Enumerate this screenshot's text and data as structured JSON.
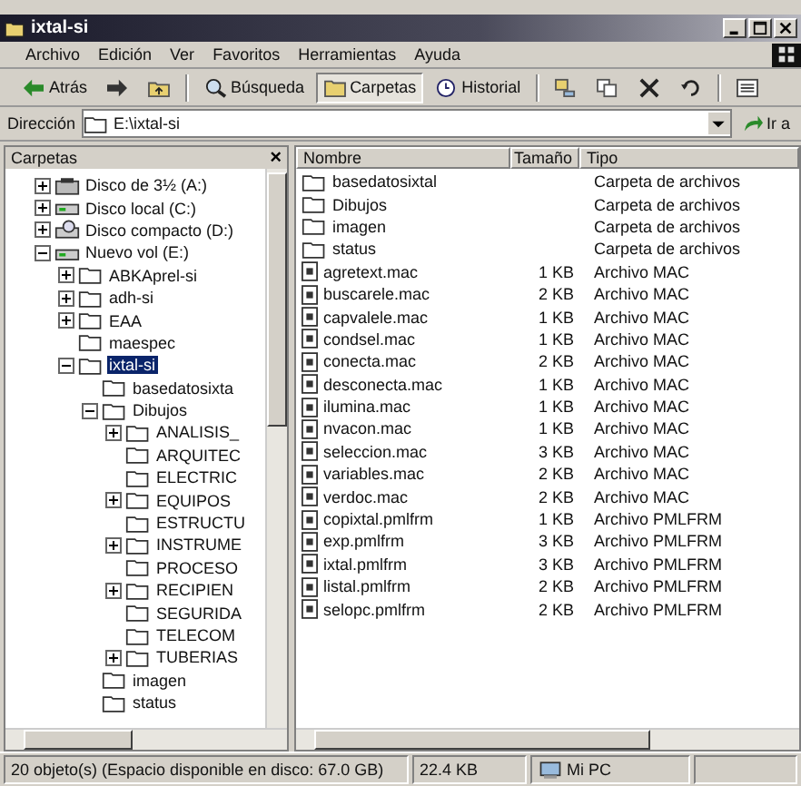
{
  "window": {
    "title": "ixtal-si"
  },
  "menu": [
    "Archivo",
    "Edición",
    "Ver",
    "Favoritos",
    "Herramientas",
    "Ayuda"
  ],
  "toolbar": [
    {
      "kind": "back",
      "label": "Atrás",
      "pressed": false
    },
    {
      "kind": "forward",
      "pressed": false
    },
    {
      "kind": "up",
      "pressed": false
    },
    {
      "kind": "search",
      "label": "Búsqueda",
      "pressed": false
    },
    {
      "kind": "folders",
      "label": "Carpetas",
      "pressed": true
    },
    {
      "kind": "history",
      "label": "Historial",
      "pressed": false
    },
    {
      "kind": "move",
      "pressed": false
    },
    {
      "kind": "copy",
      "pressed": false
    },
    {
      "kind": "delete",
      "pressed": false
    },
    {
      "kind": "undo",
      "pressed": false
    },
    {
      "kind": "views",
      "pressed": false
    }
  ],
  "address": {
    "label": "Dirección",
    "value": "E:\\ixtal-si",
    "go": "Ir a"
  },
  "folders_pane": {
    "title": "Carpetas",
    "close": "×"
  },
  "tree": [
    {
      "label": "Disco de 3½ (A:)",
      "kind": "floppy",
      "expanded": false,
      "selected": false
    },
    {
      "label": "Disco local (C:)",
      "kind": "drive",
      "expanded": false,
      "selected": false
    },
    {
      "label": "Disco compacto (D:)",
      "kind": "cd",
      "expanded": false,
      "selected": false
    },
    {
      "label": "Nuevo vol (E:)",
      "kind": "drive",
      "expanded": true,
      "selected": false,
      "children": [
        {
          "label": "ABKAprel-si",
          "kind": "folder",
          "expanded": false,
          "selected": false
        },
        {
          "label": "adh-si",
          "kind": "folder",
          "expanded": false,
          "selected": false
        },
        {
          "label": "EAA",
          "kind": "folder",
          "expanded": false,
          "selected": false
        },
        {
          "label": "maespec",
          "kind": "folder",
          "selected": false
        },
        {
          "label": "ixtal-si",
          "kind": "folder",
          "expanded": true,
          "selected": true,
          "children": [
            {
              "label": "basedatosixta",
              "kind": "folder",
              "selected": false
            },
            {
              "label": "Dibujos",
              "kind": "folder",
              "expanded": true,
              "selected": false,
              "children": [
                {
                  "label": "ANALISIS_",
                  "kind": "folder",
                  "expanded": false,
                  "selected": false
                },
                {
                  "label": "ARQUITEC",
                  "kind": "folder",
                  "selected": false
                },
                {
                  "label": "ELECTRIC",
                  "kind": "folder",
                  "selected": false
                },
                {
                  "label": "EQUIPOS",
                  "kind": "folder",
                  "expanded": false,
                  "selected": false
                },
                {
                  "label": "ESTRUCTU",
                  "kind": "folder",
                  "selected": false
                },
                {
                  "label": "INSTRUME",
                  "kind": "folder",
                  "expanded": false,
                  "selected": false
                },
                {
                  "label": "PROCESO",
                  "kind": "folder",
                  "selected": false
                },
                {
                  "label": "RECIPIEN",
                  "kind": "folder",
                  "expanded": false,
                  "selected": false
                },
                {
                  "label": "SEGURIDA",
                  "kind": "folder",
                  "selected": false
                },
                {
                  "label": "TELECOM",
                  "kind": "folder",
                  "selected": false
                },
                {
                  "label": "TUBERIAS",
                  "kind": "folder",
                  "expanded": false,
                  "selected": false
                }
              ]
            },
            {
              "label": "imagen",
              "kind": "folder",
              "selected": false
            },
            {
              "label": "status",
              "kind": "folder",
              "selected": false
            }
          ]
        }
      ]
    }
  ],
  "table": {
    "columns": [
      "Nombre",
      "Tamaño",
      "Tipo"
    ],
    "rows": [
      {
        "kind": "folder",
        "name": "basedatosixtal",
        "type": "Carpeta de archivos"
      },
      {
        "kind": "folder",
        "name": "Dibujos",
        "type": "Carpeta de archivos"
      },
      {
        "kind": "folder",
        "name": "imagen",
        "type": "Carpeta de archivos"
      },
      {
        "kind": "folder",
        "name": "status",
        "type": "Carpeta de archivos"
      },
      {
        "kind": "file",
        "name": "agretext.mac",
        "size": "1 KB",
        "type": "Archivo MAC"
      },
      {
        "kind": "file",
        "name": "buscarele.mac",
        "size": "2 KB",
        "type": "Archivo MAC"
      },
      {
        "kind": "file",
        "name": "capvalele.mac",
        "size": "1 KB",
        "type": "Archivo MAC"
      },
      {
        "kind": "file",
        "name": "condsel.mac",
        "size": "1 KB",
        "type": "Archivo MAC"
      },
      {
        "kind": "file",
        "name": "conecta.mac",
        "size": "2 KB",
        "type": "Archivo MAC"
      },
      {
        "kind": "file",
        "name": "desconecta.mac",
        "size": "1 KB",
        "type": "Archivo MAC"
      },
      {
        "kind": "file",
        "name": "ilumina.mac",
        "size": "1 KB",
        "type": "Archivo MAC"
      },
      {
        "kind": "file",
        "name": "nvacon.mac",
        "size": "1 KB",
        "type": "Archivo MAC"
      },
      {
        "kind": "file",
        "name": "seleccion.mac",
        "size": "3 KB",
        "type": "Archivo MAC"
      },
      {
        "kind": "file",
        "name": "variables.mac",
        "size": "2 KB",
        "type": "Archivo MAC"
      },
      {
        "kind": "file",
        "name": "verdoc.mac",
        "size": "2 KB",
        "type": "Archivo MAC"
      },
      {
        "kind": "file",
        "name": "copixtal.pmlfrm",
        "size": "1 KB",
        "type": "Archivo PMLFRM"
      },
      {
        "kind": "file",
        "name": "exp.pmlfrm",
        "size": "3 KB",
        "type": "Archivo PMLFRM"
      },
      {
        "kind": "file",
        "name": "ixtal.pmlfrm",
        "size": "3 KB",
        "type": "Archivo PMLFRM"
      },
      {
        "kind": "file",
        "name": "listal.pmlfrm",
        "size": "2 KB",
        "type": "Archivo PMLFRM"
      },
      {
        "kind": "file",
        "name": "selopc.pmlfrm",
        "size": "2 KB",
        "type": "Archivo PMLFRM"
      }
    ]
  },
  "status_bar": [
    "20 objeto(s) (Espacio disponible en disco: 67.0 GB)",
    "22.4 KB",
    "Mi PC"
  ]
}
